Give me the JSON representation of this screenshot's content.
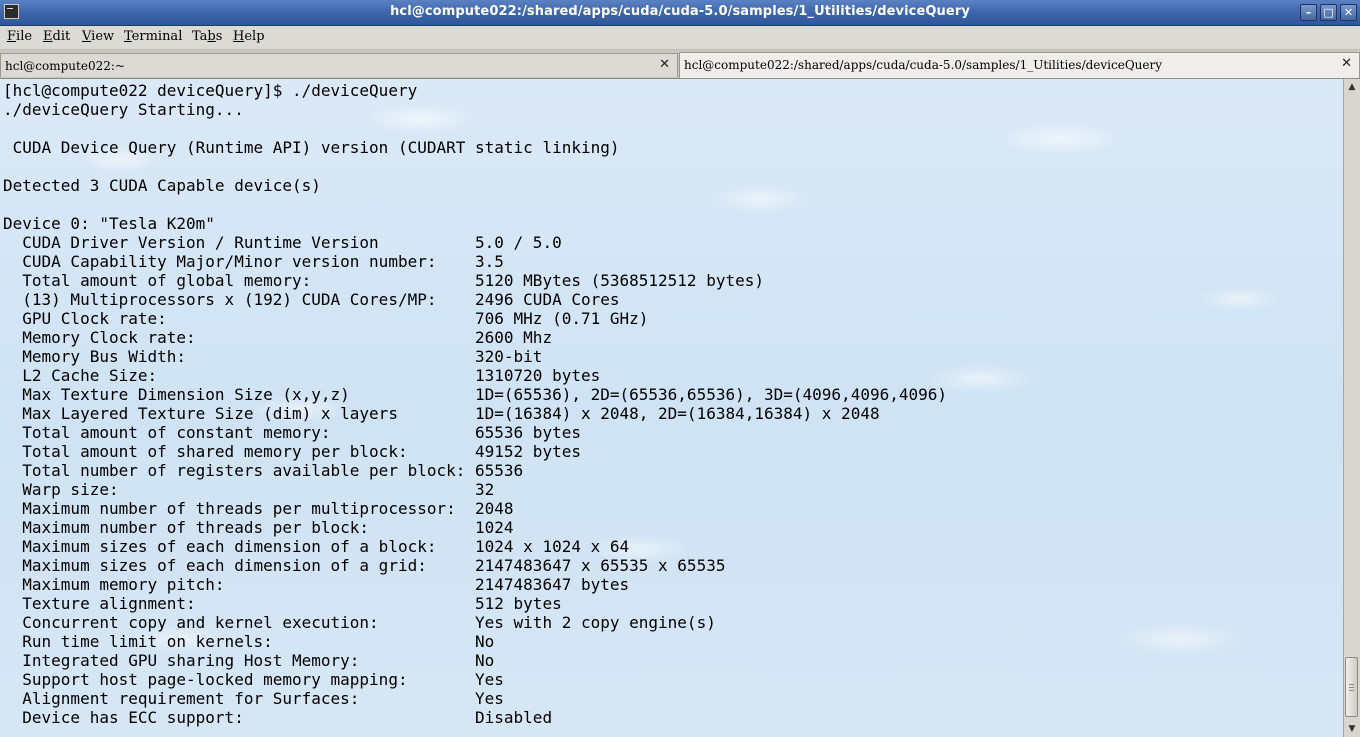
{
  "window": {
    "title": "hcl@compute022:/shared/apps/cuda/cuda-5.0/samples/1_Utilities/deviceQuery",
    "minimize_label": "–",
    "maximize_label": "□",
    "close_label": "✕"
  },
  "menu": [
    {
      "label": "File",
      "mnemonic": "F",
      "rest": "ile"
    },
    {
      "label": "Edit",
      "mnemonic": "E",
      "rest": "dit"
    },
    {
      "label": "View",
      "mnemonic": "V",
      "rest": "iew"
    },
    {
      "label": "Terminal",
      "mnemonic": "T",
      "rest": "erminal"
    },
    {
      "label": "Tabs",
      "pre": "Ta",
      "mnemonic": "b",
      "rest": "s"
    },
    {
      "label": "Help",
      "mnemonic": "H",
      "rest": "elp"
    }
  ],
  "tabs": [
    {
      "label": "hcl@compute022:~",
      "close": "✕",
      "active": false
    },
    {
      "label": "hcl@compute022:/shared/apps/cuda/cuda-5.0/samples/1_Utilities/deviceQuery",
      "close": "✕",
      "active": true
    }
  ],
  "terminal": {
    "lines": [
      "[hcl@compute022 deviceQuery]$ ./deviceQuery",
      "./deviceQuery Starting...",
      "",
      " CUDA Device Query (Runtime API) version (CUDART static linking)",
      "",
      "Detected 3 CUDA Capable device(s)",
      "",
      "Device 0: \"Tesla K20m\"",
      "  CUDA Driver Version / Runtime Version          5.0 / 5.0",
      "  CUDA Capability Major/Minor version number:    3.5",
      "  Total amount of global memory:                 5120 MBytes (5368512512 bytes)",
      "  (13) Multiprocessors x (192) CUDA Cores/MP:    2496 CUDA Cores",
      "  GPU Clock rate:                                706 MHz (0.71 GHz)",
      "  Memory Clock rate:                             2600 Mhz",
      "  Memory Bus Width:                              320-bit",
      "  L2 Cache Size:                                 1310720 bytes",
      "  Max Texture Dimension Size (x,y,z)             1D=(65536), 2D=(65536,65536), 3D=(4096,4096,4096)",
      "  Max Layered Texture Size (dim) x layers        1D=(16384) x 2048, 2D=(16384,16384) x 2048",
      "  Total amount of constant memory:               65536 bytes",
      "  Total amount of shared memory per block:       49152 bytes",
      "  Total number of registers available per block: 65536",
      "  Warp size:                                     32",
      "  Maximum number of threads per multiprocessor:  2048",
      "  Maximum number of threads per block:           1024",
      "  Maximum sizes of each dimension of a block:    1024 x 1024 x 64",
      "  Maximum sizes of each dimension of a grid:     2147483647 x 65535 x 65535",
      "  Maximum memory pitch:                          2147483647 bytes",
      "  Texture alignment:                             512 bytes",
      "  Concurrent copy and kernel execution:          Yes with 2 copy engine(s)",
      "  Run time limit on kernels:                     No",
      "  Integrated GPU sharing Host Memory:            No",
      "  Support host page-locked memory mapping:       Yes",
      "  Alignment requirement for Surfaces:            Yes",
      "  Device has ECC support:                        Disabled"
    ]
  },
  "scrollbar": {
    "up_icon": "▲",
    "down_icon": "▼",
    "position_fraction": 0.97
  }
}
